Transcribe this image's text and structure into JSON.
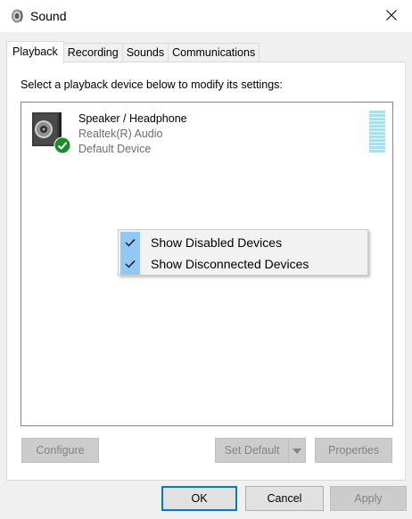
{
  "window": {
    "title": "Sound",
    "icon": "speaker-icon",
    "close_icon": "close-icon"
  },
  "tabs": [
    {
      "label": "Playback",
      "active": true
    },
    {
      "label": "Recording",
      "active": false
    },
    {
      "label": "Sounds",
      "active": false
    },
    {
      "label": "Communications",
      "active": false
    }
  ],
  "playback": {
    "instruction": "Select a playback device below to modify its settings:",
    "devices": [
      {
        "name": "Speaker / Headphone",
        "driver": "Realtek(R) Audio",
        "status": "Default Device",
        "icon": "speaker-device-icon",
        "badge": "default-check-icon",
        "level_meter": "level-meter"
      }
    ]
  },
  "context_menu": {
    "items": [
      {
        "label": "Show Disabled Devices",
        "checked": true
      },
      {
        "label": "Show Disconnected Devices",
        "checked": true
      }
    ]
  },
  "buttons": {
    "configure": "Configure",
    "set_default": "Set Default",
    "properties": "Properties",
    "ok": "OK",
    "cancel": "Cancel",
    "apply": "Apply"
  },
  "colors": {
    "accent": "#0078d7",
    "menu_check_bg": "#90c8f6",
    "badge_green": "#1b8c2b",
    "meter": "#a9dfe7"
  }
}
